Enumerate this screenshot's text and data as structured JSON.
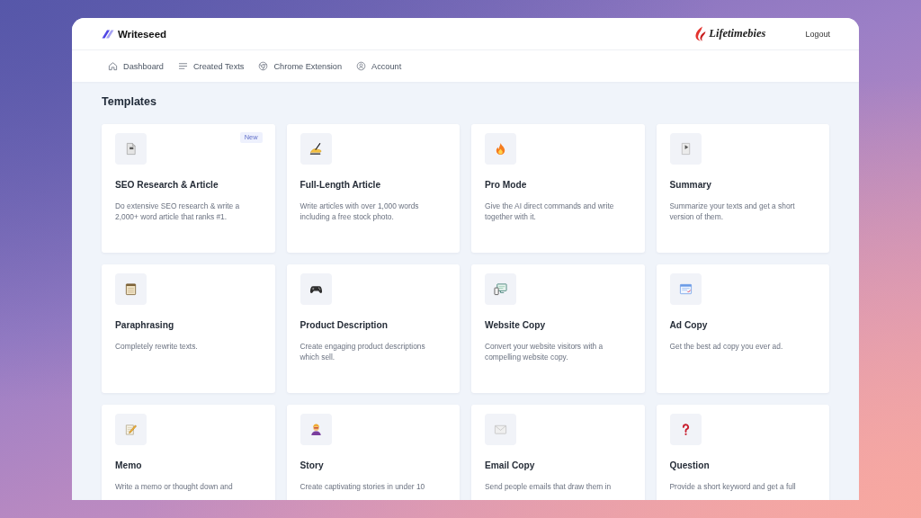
{
  "header": {
    "brand": "Writeseed",
    "partner_brand": "Lifetimebies",
    "logout": "Logout"
  },
  "nav": [
    {
      "label": "Dashboard"
    },
    {
      "label": "Created Texts"
    },
    {
      "label": "Chrome Extension"
    },
    {
      "label": "Account"
    }
  ],
  "section_title": "Templates",
  "templates": [
    {
      "title": "SEO Research & Article",
      "description": "Do extensive SEO research & write a 2,000+ word article that ranks #1.",
      "badge": "New"
    },
    {
      "title": "Full-Length Article",
      "description": "Write articles with over 1,000 words including a free stock photo."
    },
    {
      "title": "Pro Mode",
      "description": "Give the AI direct commands and write together with it."
    },
    {
      "title": "Summary",
      "description": "Summarize your texts and get a short version of them."
    },
    {
      "title": "Paraphrasing",
      "description": "Completely rewrite texts."
    },
    {
      "title": "Product Description",
      "description": "Create engaging product descriptions which sell."
    },
    {
      "title": "Website Copy",
      "description": "Convert your website visitors with a compelling website copy."
    },
    {
      "title": "Ad Copy",
      "description": "Get the best ad copy you ever ad."
    },
    {
      "title": "Memo",
      "description": "Write a memo or thought down and"
    },
    {
      "title": "Story",
      "description": "Create captivating stories in under 10"
    },
    {
      "title": "Email Copy",
      "description": "Send people emails that draw them in"
    },
    {
      "title": "Question",
      "description": "Provide a short keyword and get a full"
    }
  ]
}
